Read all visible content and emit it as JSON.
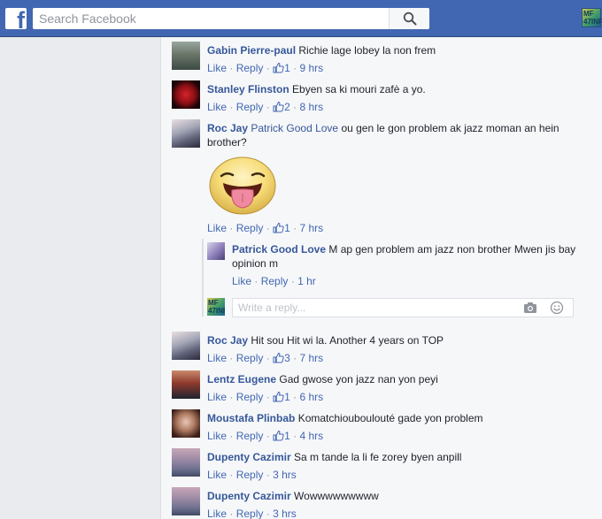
{
  "header": {
    "logo_letter": "f",
    "search_placeholder": "Search Facebook",
    "profile_initials": "MF\n47INF"
  },
  "actions": {
    "like": "Like",
    "reply": "Reply",
    "sep": "·"
  },
  "comments": [
    {
      "author": "Gabin Pierre-paul",
      "text": "Richie lage lobey la non frem",
      "likes": "1",
      "time": "9 hrs"
    },
    {
      "author": "Stanley Flinston",
      "text": "Ebyen sa ki mouri zafè a yo.",
      "likes": "2",
      "time": "8 hrs"
    },
    {
      "author": "Roc Jay",
      "mention": "Patrick Good Love",
      "text": "ou gen le gon problem ak jazz moman an hein brother?",
      "likes": "1",
      "time": "7 hrs"
    },
    {
      "author": "Roc Jay",
      "text": "Hit sou Hit wi la. Another 4 years on TOP",
      "likes": "3",
      "time": "7 hrs"
    },
    {
      "author": "Lentz Eugene",
      "text": "Gad gwose yon jazz nan yon peyi",
      "likes": "1",
      "time": "6 hrs"
    },
    {
      "author": "Moustafa Plinbab",
      "text": "Komatchiouboulouté gade yon problem",
      "likes": "1",
      "time": "4 hrs"
    },
    {
      "author": "Dupenty Cazimir",
      "text": "Sa m tande la li fe zorey byen anpill",
      "time": "3 hrs"
    },
    {
      "author": "Dupenty Cazimir",
      "text": "Wowwwwwwwww",
      "time": "3 hrs"
    }
  ],
  "reply": {
    "author": "Patrick Good Love",
    "text": "M ap gen problem am jazz non brother Mwen jis bay opinion m",
    "time": "1 hr"
  },
  "reply_composer": {
    "placeholder": "Write a reply..."
  },
  "colors": {
    "brand": "#4267b2",
    "link": "#365899",
    "meta": "#90949c"
  }
}
